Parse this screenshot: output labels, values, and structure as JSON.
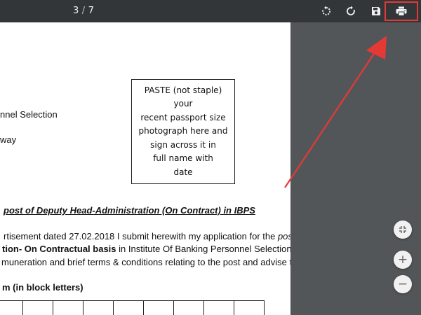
{
  "toolbar": {
    "current_page": "3",
    "separator": "/",
    "total_pages": "7",
    "buttons": {
      "rotate_ccw": "rotate-counterclockwise-icon",
      "rotate_cw": "rotate-clockwise-icon",
      "download": "save-download-icon",
      "print": "print-icon"
    }
  },
  "document": {
    "partial_line_1": "nnel Selection",
    "partial_line_2": "way",
    "photo_box_lines": [
      "PASTE (not staple)",
      "your",
      "recent passport size",
      "photograph here and",
      "sign across it in",
      "full name with",
      "date"
    ],
    "post_title": "post of  Deputy Head-Administration (On Contract) in IBPS",
    "para_line_1_a": "rtisement dated 27.02.2018 I submit herewith my application for the ",
    "para_line_1_b": "post of",
    "para_line_2_a": "tion- On Contractual basis",
    "para_line_2_b": " in Institute Of Banking Personnel Selection. I",
    "para_line_3": "muneration and brief terms & conditions relating to the post and advise that",
    "name_label": "m (in block letters)"
  },
  "zoom": {
    "fit_icon": "fit-to-page-icon",
    "zoom_in_label": "+",
    "zoom_out_label": "−"
  },
  "colors": {
    "toolbar_bg": "#323639",
    "viewer_bg": "#525659",
    "annotation_red": "#e53935"
  }
}
